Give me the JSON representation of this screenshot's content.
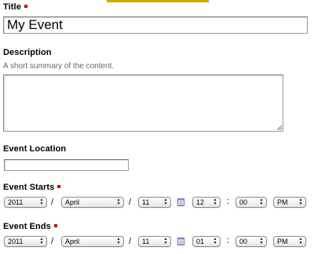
{
  "form": {
    "title": {
      "label": "Title",
      "value": "My Event"
    },
    "description": {
      "label": "Description",
      "help": "A short summary of the content.",
      "value": ""
    },
    "location": {
      "label": "Event Location",
      "value": ""
    },
    "starts": {
      "label": "Event Starts",
      "year": "2011",
      "month": "April",
      "day": "11",
      "hour": "12",
      "minute": "00",
      "ampm": "PM",
      "date_sep": "/",
      "time_sep": ":"
    },
    "ends": {
      "label": "Event Ends",
      "year": "2011",
      "month": "April",
      "day": "11",
      "hour": "01",
      "minute": "00",
      "ampm": "PM",
      "date_sep": "/",
      "time_sep": ":"
    }
  },
  "colors": {
    "required_marker": "#cc0000",
    "top_strip": "#c9a800",
    "help_text": "#666666"
  },
  "icons": {
    "required": "required-marker-icon",
    "calendar": "calendar-icon",
    "select_arrows": "chevron-up-down-icon",
    "resize": "resize-grip-icon"
  }
}
